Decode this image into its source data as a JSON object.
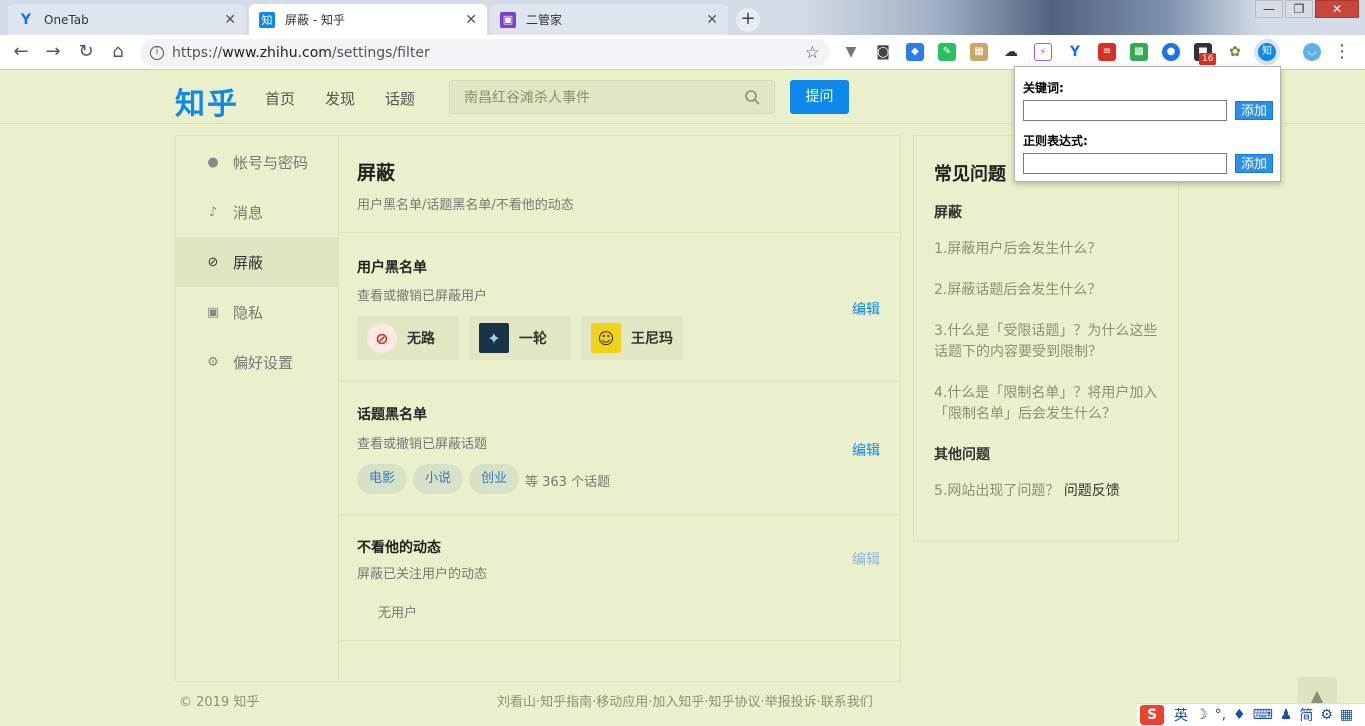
{
  "browser": {
    "tabs": [
      {
        "title": "OneTab",
        "icon": "onetab-icon",
        "color": "#1a73e8"
      },
      {
        "title": "屏蔽 - 知乎",
        "icon": "zhihu-icon",
        "color": "#0f88eb"
      },
      {
        "title": "二管家",
        "icon": "erguanjia-icon",
        "color": "#7b3fd1"
      }
    ],
    "url_prefix": "https://",
    "url_host": "www.zhihu.com",
    "url_path": "/settings/filter",
    "ext_badge": "16"
  },
  "header": {
    "logo": "知乎",
    "nav": [
      "首页",
      "发现",
      "话题"
    ],
    "search_placeholder": "南昌红谷滩杀人事件",
    "ask_label": "提问"
  },
  "sidebar": {
    "items": [
      {
        "label": "帐号与密码",
        "icon": "user-icon"
      },
      {
        "label": "消息",
        "icon": "bell-icon"
      },
      {
        "label": "屏蔽",
        "icon": "block-icon"
      },
      {
        "label": "隐私",
        "icon": "lock-icon"
      },
      {
        "label": "偏好设置",
        "icon": "gear-icon"
      }
    ]
  },
  "content": {
    "title": "屏蔽",
    "subtitle": "用户黑名单/话题黑名单/不看他的动态",
    "user_blacklist": {
      "title": "用户黑名单",
      "desc": "查看或撤销已屏蔽用户",
      "edit": "编辑",
      "users": [
        "无路",
        "一轮",
        "王尼玛"
      ]
    },
    "topic_blacklist": {
      "title": "话题黑名单",
      "desc": "查看或撤销已屏蔽话题",
      "edit": "编辑",
      "topics": [
        "电影",
        "小说",
        "创业"
      ],
      "more": "等 363 个话题"
    },
    "not_follow": {
      "title": "不看他的动态",
      "desc": "屏蔽已关注用户的动态",
      "edit": "编辑",
      "empty": "无用户"
    }
  },
  "faq": {
    "title": "常见问题",
    "section1": "屏蔽",
    "q1": "1.屏蔽用户后会发生什么？",
    "q2": "2.屏蔽话题后会发生什么？",
    "q3": "3.什么是「受限话题」？为什么这些话题下的内容要受到限制？",
    "q4": "4.什么是「限制名单」？将用户加入「限制名单」后会发生什么？",
    "section2": "其他问题",
    "q5_prefix": "5.网站出现了问题？",
    "q5_link": "问题反馈"
  },
  "footer": {
    "copyright": "© 2019 知乎",
    "links": "刘看山·知乎指南·移动应用·加入知乎·知乎协议·举报投诉·联系我们"
  },
  "popup": {
    "keyword_label": "关键词:",
    "keyword_value": "",
    "regex_label": "正则表达式:",
    "regex_value": "",
    "add_label": "添加"
  },
  "tray": {
    "lang": "英",
    "mode": "简"
  }
}
